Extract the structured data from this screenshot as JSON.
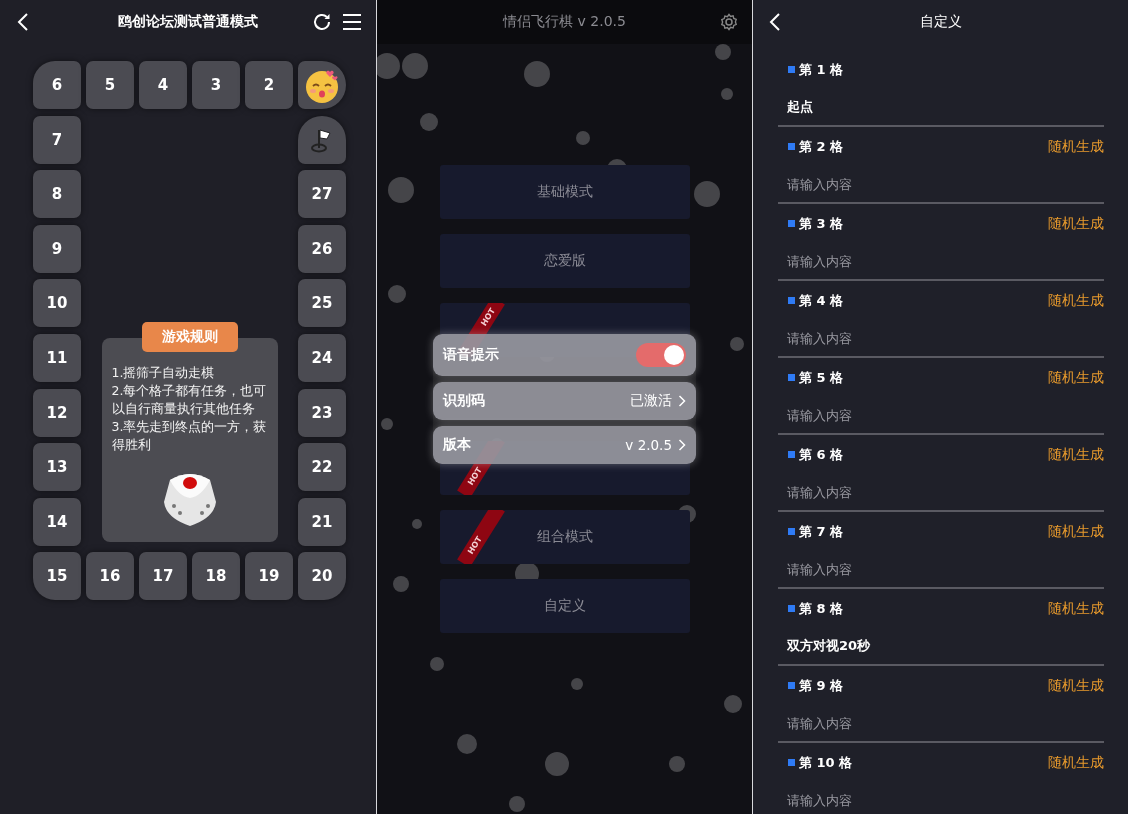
{
  "board": {
    "title": "鸥创论坛测试普通模式",
    "cells": [
      {
        "kind": "number",
        "label": "6"
      },
      {
        "kind": "number",
        "label": "5"
      },
      {
        "kind": "number",
        "label": "4"
      },
      {
        "kind": "number",
        "label": "3"
      },
      {
        "kind": "number",
        "label": "2"
      },
      {
        "kind": "start"
      },
      {
        "kind": "number",
        "label": "7"
      },
      {
        "kind": "finish"
      },
      {
        "kind": "number",
        "label": "8"
      },
      {
        "kind": "number",
        "label": "27"
      },
      {
        "kind": "number",
        "label": "9"
      },
      {
        "kind": "number",
        "label": "26"
      },
      {
        "kind": "number",
        "label": "10"
      },
      {
        "kind": "number",
        "label": "25"
      },
      {
        "kind": "number",
        "label": "11"
      },
      {
        "kind": "number",
        "label": "24"
      },
      {
        "kind": "number",
        "label": "12"
      },
      {
        "kind": "number",
        "label": "23"
      },
      {
        "kind": "number",
        "label": "13"
      },
      {
        "kind": "number",
        "label": "22"
      },
      {
        "kind": "number",
        "label": "14"
      },
      {
        "kind": "number",
        "label": "21"
      },
      {
        "kind": "number",
        "label": "15"
      },
      {
        "kind": "number",
        "label": "16"
      },
      {
        "kind": "number",
        "label": "17"
      },
      {
        "kind": "number",
        "label": "18"
      },
      {
        "kind": "number",
        "label": "19"
      },
      {
        "kind": "number",
        "label": "20"
      }
    ],
    "rules": {
      "title": "游戏规则",
      "lines": [
        "1.摇筛子自动走棋",
        "2.每个格子都有任务，也可以自行商量执行其他任务",
        "3.率先走到终点的一方，获得胜利"
      ]
    }
  },
  "menu": {
    "title": "情侣飞行棋 v 2.0.5",
    "modes": [
      {
        "label": "基础模式"
      },
      {
        "label": "恋爱版"
      },
      {
        "ribbon": "HOT"
      },
      {
        "ribbon": "HOT"
      },
      {
        "label": "组合模式",
        "ribbon": "HOT"
      },
      {
        "label": "自定义"
      }
    ],
    "settings": [
      {
        "kind": "switch",
        "label": "语音提示",
        "on": true
      },
      {
        "kind": "link",
        "label": "识别码",
        "value": "已激活"
      },
      {
        "kind": "link",
        "label": "版本",
        "value": "v 2.0.5"
      }
    ]
  },
  "custom": {
    "title": "自定义",
    "cells": [
      {
        "label": "第 1 格",
        "value": "起点"
      },
      {
        "label": "第 2 格",
        "action": "随机生成",
        "placeholder": "请输入内容"
      },
      {
        "label": "第 3 格",
        "action": "随机生成",
        "placeholder": "请输入内容"
      },
      {
        "label": "第 4 格",
        "action": "随机生成",
        "placeholder": "请输入内容"
      },
      {
        "label": "第 5 格",
        "action": "随机生成",
        "placeholder": "请输入内容"
      },
      {
        "label": "第 6 格",
        "action": "随机生成",
        "placeholder": "请输入内容"
      },
      {
        "label": "第 7 格",
        "action": "随机生成",
        "placeholder": "请输入内容"
      },
      {
        "label": "第 8 格",
        "action": "随机生成",
        "value": "双方对视20秒"
      },
      {
        "label": "第 9 格",
        "action": "随机生成",
        "placeholder": "请输入内容"
      },
      {
        "label": "第 10 格",
        "action": "随机生成",
        "placeholder": "请输入内容"
      }
    ]
  }
}
